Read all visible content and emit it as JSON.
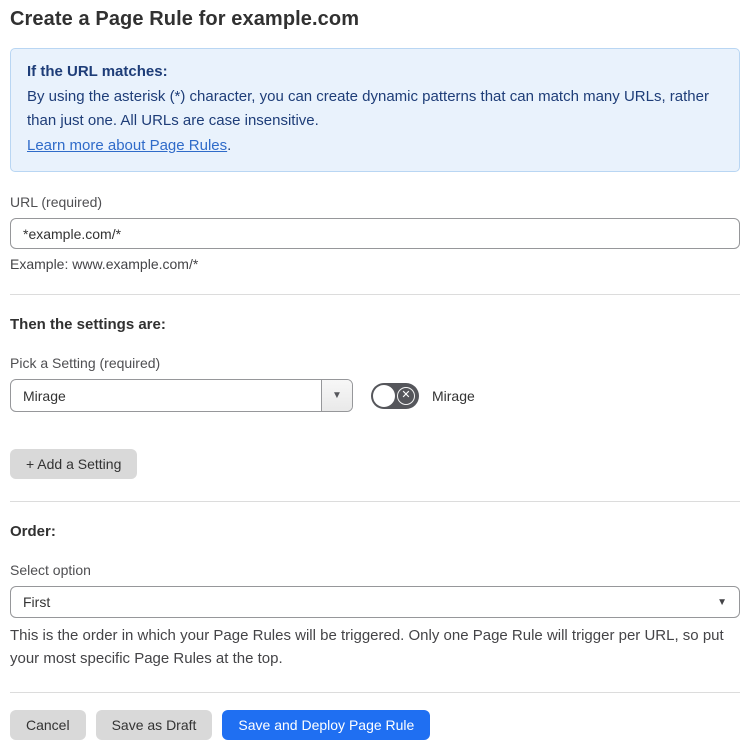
{
  "page": {
    "title": "Create a Page Rule for example.com"
  },
  "info_box": {
    "heading": "If the URL matches:",
    "body": "By using the asterisk (*) character, you can create dynamic patterns that can match many URLs, rather than just one. All URLs are case insensitive.",
    "link_label": "Learn more about Page Rules",
    "link_suffix": "."
  },
  "url_field": {
    "label": "URL (required)",
    "value": "*example.com/*",
    "helper": "Example: www.example.com/*"
  },
  "settings_section": {
    "heading": "Then the settings are:",
    "pick_label": "Pick a Setting (required)",
    "selected_setting": "Mirage",
    "dropdown_arrow": "▼",
    "toggle_state": "off",
    "toggle_x": "✕",
    "toggle_label": "Mirage",
    "add_setting_label": "+ Add a Setting"
  },
  "order_section": {
    "heading": "Order:",
    "label": "Select option",
    "selected_option": "First",
    "caret": "▼",
    "helper": "This is the order in which your Page Rules will be triggered. Only one Page Rule will trigger per URL, so put your most specific Page Rules at the top."
  },
  "footer": {
    "cancel_label": "Cancel",
    "save_draft_label": "Save as Draft",
    "save_deploy_label": "Save and Deploy Page Rule"
  },
  "colors": {
    "info_bg": "#e9f2fc",
    "info_border": "#b9d6f3",
    "info_text": "#1e3d78",
    "link": "#2f6bc9",
    "primary_button": "#1f6ff2",
    "secondary_button": "#d9d9d9",
    "toggle_track": "#55565b"
  }
}
